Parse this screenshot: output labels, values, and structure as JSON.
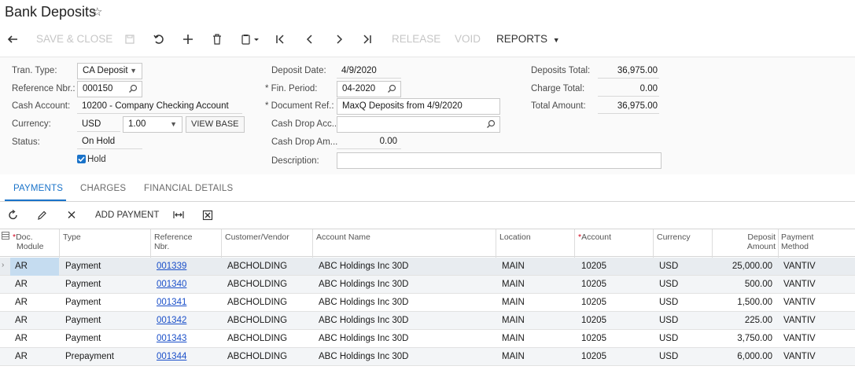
{
  "header": {
    "title": "Bank Deposits"
  },
  "toolbar": {
    "save_close": "SAVE & CLOSE",
    "release": "RELEASE",
    "void": "VOID",
    "reports": "REPORTS"
  },
  "form": {
    "tran_type_label": "Tran. Type:",
    "tran_type_value": "CA Deposit",
    "ref_nbr_label": "Reference Nbr.:",
    "ref_nbr_value": "000150",
    "cash_account_label": "Cash Account:",
    "cash_account_value": "10200 - Company Checking Account",
    "currency_label": "Currency:",
    "currency_value": "USD",
    "rate_value": "1.00",
    "view_base_label": "VIEW BASE",
    "status_label": "Status:",
    "status_value": "On Hold",
    "hold_label": "Hold",
    "deposit_date_label": "Deposit Date:",
    "deposit_date_value": "4/9/2020",
    "fin_period_label": "Fin. Period:",
    "fin_period_value": "04-2020",
    "doc_ref_label": "Document Ref.:",
    "doc_ref_value": "MaxQ Deposits from 4/9/2020",
    "cash_drop_acc_label": "Cash Drop Acc...",
    "cash_drop_acc_value": "",
    "cash_drop_am_label": "Cash Drop Am...",
    "cash_drop_am_value": "0.00",
    "description_label": "Description:",
    "description_value": "",
    "deposits_total_label": "Deposits Total:",
    "deposits_total_value": "36,975.00",
    "charge_total_label": "Charge Total:",
    "charge_total_value": "0.00",
    "total_amount_label": "Total Amount:",
    "total_amount_value": "36,975.00"
  },
  "tabs": [
    {
      "label": "PAYMENTS",
      "active": true
    },
    {
      "label": "CHARGES",
      "active": false
    },
    {
      "label": "FINANCIAL DETAILS",
      "active": false
    }
  ],
  "gridbar": {
    "add_payment": "ADD PAYMENT"
  },
  "columns": {
    "doc_module_1": "Doc.",
    "doc_module_2": "Module",
    "type": "Type",
    "ref_1": "Reference",
    "ref_2": "Nbr.",
    "customer": "Customer/Vendor",
    "account_name": "Account Name",
    "location": "Location",
    "account": "Account",
    "currency": "Currency",
    "deposit_1": "Deposit",
    "deposit_2": "Amount",
    "method_1": "Payment",
    "method_2": "Method"
  },
  "rows": [
    {
      "module": "AR",
      "type": "Payment",
      "ref": "001339",
      "customer": "ABCHOLDING",
      "account_name": "ABC Holdings Inc 30D",
      "location": "MAIN",
      "account": "10205",
      "currency": "USD",
      "amount": "25,000.00",
      "method": "VANTIV"
    },
    {
      "module": "AR",
      "type": "Payment",
      "ref": "001340",
      "customer": "ABCHOLDING",
      "account_name": "ABC Holdings Inc 30D",
      "location": "MAIN",
      "account": "10205",
      "currency": "USD",
      "amount": "500.00",
      "method": "VANTIV"
    },
    {
      "module": "AR",
      "type": "Payment",
      "ref": "001341",
      "customer": "ABCHOLDING",
      "account_name": "ABC Holdings Inc 30D",
      "location": "MAIN",
      "account": "10205",
      "currency": "USD",
      "amount": "1,500.00",
      "method": "VANTIV"
    },
    {
      "module": "AR",
      "type": "Payment",
      "ref": "001342",
      "customer": "ABCHOLDING",
      "account_name": "ABC Holdings Inc 30D",
      "location": "MAIN",
      "account": "10205",
      "currency": "USD",
      "amount": "225.00",
      "method": "VANTIV"
    },
    {
      "module": "AR",
      "type": "Payment",
      "ref": "001343",
      "customer": "ABCHOLDING",
      "account_name": "ABC Holdings Inc 30D",
      "location": "MAIN",
      "account": "10205",
      "currency": "USD",
      "amount": "3,750.00",
      "method": "VANTIV"
    },
    {
      "module": "AR",
      "type": "Prepayment",
      "ref": "001344",
      "customer": "ABCHOLDING",
      "account_name": "ABC Holdings Inc 30D",
      "location": "MAIN",
      "account": "10205",
      "currency": "USD",
      "amount": "6,000.00",
      "method": "VANTIV"
    }
  ],
  "colors": {
    "accent": "#1a73c9",
    "link": "#1a4fc9",
    "required": "#d0021b"
  }
}
